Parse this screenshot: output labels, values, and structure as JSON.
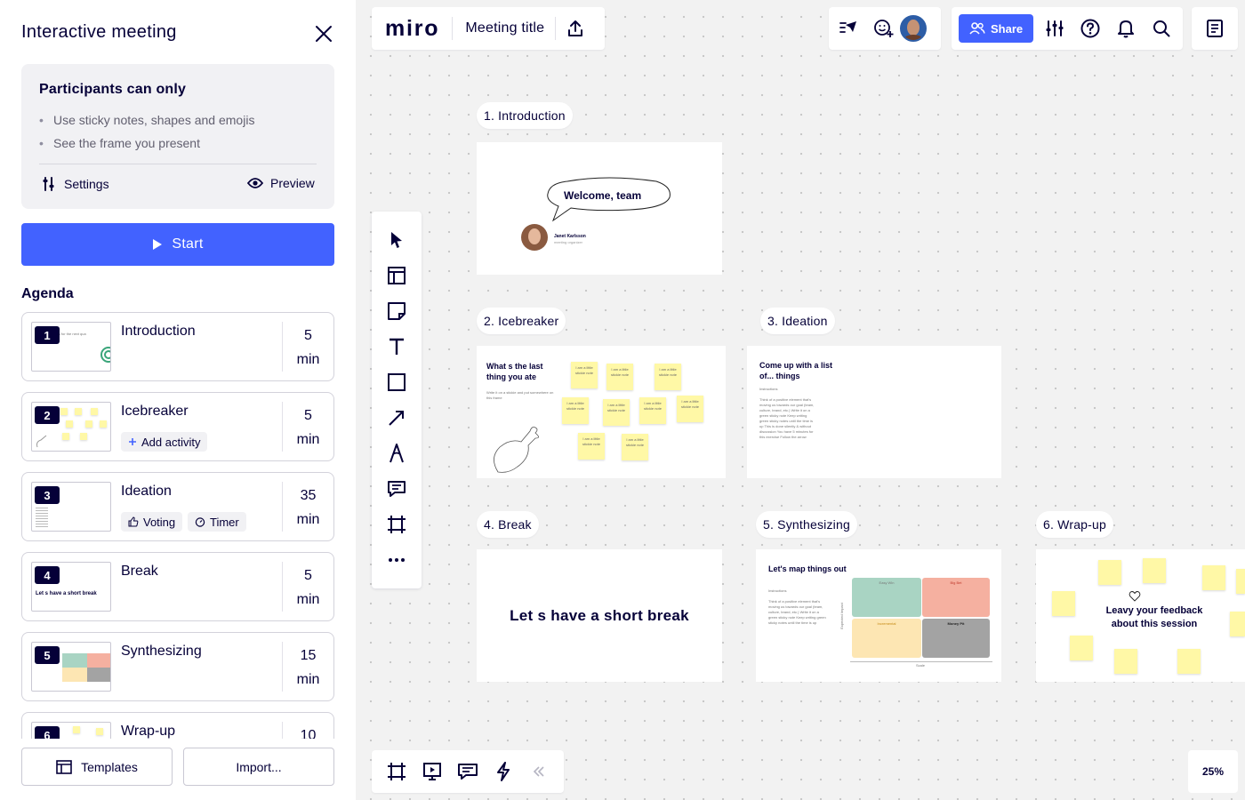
{
  "panel": {
    "title": "Interactive meeting",
    "rules_title": "Participants can only",
    "rules": [
      "Use sticky notes, shapes and emojis",
      "See the frame you present"
    ],
    "settings_label": "Settings",
    "preview_label": "Preview",
    "start_label": "Start",
    "agenda_title": "Agenda",
    "agenda": [
      {
        "num": "1",
        "name": "Introduction",
        "dur_value": "5",
        "dur_unit": "min"
      },
      {
        "num": "2",
        "name": "Icebreaker",
        "dur_value": "5",
        "dur_unit": "min",
        "chip": "Add activity"
      },
      {
        "num": "3",
        "name": "Ideation",
        "dur_value": "35",
        "dur_unit": "min",
        "chips": [
          "Voting",
          "Timer"
        ]
      },
      {
        "num": "4",
        "name": "Break",
        "dur_value": "5",
        "dur_unit": "min",
        "thumb_text": "Let s have a short break"
      },
      {
        "num": "5",
        "name": "Synthesizing",
        "dur_value": "15",
        "dur_unit": "min"
      },
      {
        "num": "6",
        "name": "Wrap-up",
        "dur_value": "10",
        "dur_unit": "min"
      }
    ],
    "thumb_intro_text": "ratives for the next qua",
    "templates_label": "Templates",
    "import_label": "Import..."
  },
  "header": {
    "logo": "miro",
    "meeting_title": "Meeting title",
    "share_label": "Share"
  },
  "zoom": "25%",
  "frames": {
    "intro": {
      "label": "1. Introduction",
      "bubble": "Welcome, team",
      "person_name": "Janet Karlsson",
      "person_role": "meeting organizer"
    },
    "icebreaker": {
      "label": "2. Icebreaker",
      "heading": "What s the last thing you ate",
      "instructions": "Write it on a stickie and put somewhere on this frame",
      "sticky_text": "I am a little stickie note"
    },
    "ideation": {
      "label": "3. Ideation",
      "heading": "Come up with a list of... things",
      "instructions_title": "Instructions",
      "instructions": "Think of a positive element that's moving us towards our goal (team, culture, brand, etc.) Write it on a green sticky note Keep writing green sticky notes until the time is up This is done silently & without discussion You have 5 minutes for this exercise Follow the arrow"
    },
    "break": {
      "label": "4. Break",
      "text": "Let s have a short break"
    },
    "synth": {
      "label": "5. Synthesizing",
      "heading": "Let's map things out",
      "instructions_title": "Instructions",
      "instructions": "Think of a positive element that's moving us towards our goal (team, culture, brand, etc.) Write it on a green sticky note Keep writing green sticky notes until the time is up",
      "quadrants": [
        "Easy Win",
        "Big Bet",
        "Incremental",
        "Money Pit"
      ],
      "x_axis": "Scale",
      "y_axis": "Expected Impact"
    },
    "wrap": {
      "label": "6. Wrap-up",
      "text": "Leavy your feedback about this session"
    }
  },
  "colors": {
    "accent": "#4262ff",
    "ink": "#050038",
    "sticky": "#fff8a6",
    "quad_green": "#a9d4c3",
    "quad_red": "#f5b0a0",
    "quad_yellow": "#fde6b3",
    "quad_gray": "#a3a3a3"
  }
}
